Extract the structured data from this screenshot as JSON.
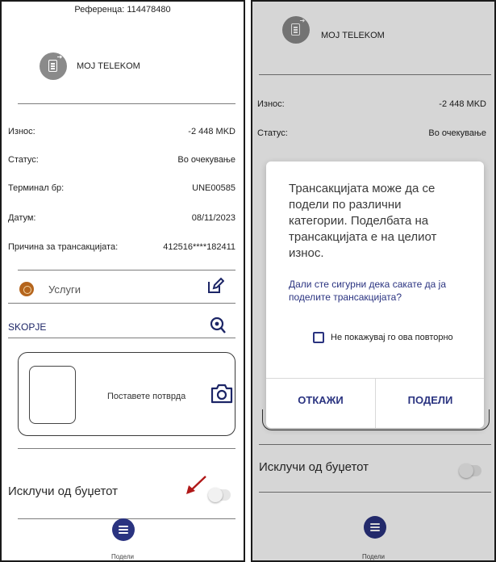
{
  "left": {
    "reference": "Референца: 114478480",
    "merchant": "МОЈ TELEKOM",
    "details": [
      {
        "label": "Износ:",
        "value": "-2 448 MKD"
      },
      {
        "label": "Статус:",
        "value": "Во очекување"
      },
      {
        "label": "Терминал бр:",
        "value": "UNE00585"
      },
      {
        "label": "Датум:",
        "value": "08/11/2023"
      },
      {
        "label": "Причина за трансакцијата:",
        "value": "412516****182411"
      }
    ],
    "category": "Услуги",
    "location": "SKOPJE",
    "receipt_prompt": "Поставете потврда",
    "exclude_budget": "Исклучи од буџетот",
    "split_label": "Подели"
  },
  "right": {
    "merchant": "МОЈ TELEKOM",
    "details": [
      {
        "label": "Износ:",
        "value": "-2 448 MKD"
      },
      {
        "label": "Статус:",
        "value": "Во очекување"
      }
    ],
    "dialog": {
      "message": "Трансакцијата може да се подели по различни категории. Поделбата на трансакцијата е на целиот износ.",
      "question": "Дали сте сигурни дека сакате да ја поделите трансакцијата?",
      "checkbox_label": "Не покажувај го ова повторно",
      "cancel": "ОТКАЖИ",
      "confirm": "ПОДЕЛИ"
    },
    "exclude_budget": "Исклучи од буџетот",
    "split_label": "Подели"
  },
  "colors": {
    "accent": "#2a3380",
    "category_icon": "#b5651d",
    "annotation_arrow": "#b01818"
  }
}
